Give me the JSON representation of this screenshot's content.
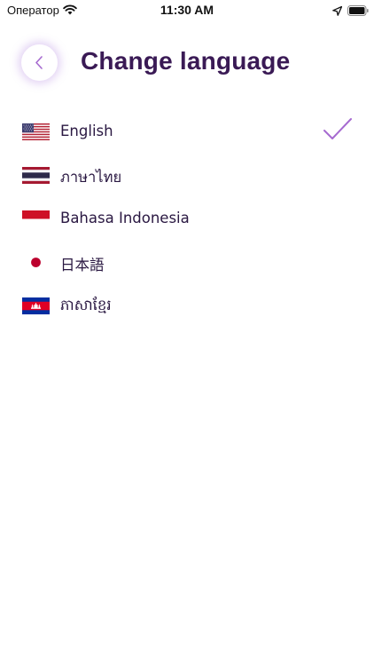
{
  "status_bar": {
    "carrier": "Оператор",
    "time": "11:30 AM",
    "icons": [
      "wifi-icon",
      "location-arrow-icon",
      "battery-icon"
    ]
  },
  "header": {
    "back_icon": "chevron-left-icon",
    "title": "Change language"
  },
  "languages": [
    {
      "label": "English",
      "flag": "us-flag-icon",
      "selected": true
    },
    {
      "label": "ภาษาไทย",
      "flag": "thailand-flag-icon",
      "selected": false
    },
    {
      "label": "Bahasa Indonesia",
      "flag": "indonesia-flag-icon",
      "selected": false
    },
    {
      "label": "日本語",
      "flag": "japan-flag-icon",
      "selected": false
    },
    {
      "label": "ភាសាខ្មែរ",
      "flag": "cambodia-flag-icon",
      "selected": false
    }
  ],
  "selected_indicator": "checkmark-icon",
  "colors": {
    "title": "#3a1a55",
    "text": "#2a1842",
    "accent": "#a66ad0",
    "back_glow": "#c8a4ea"
  }
}
